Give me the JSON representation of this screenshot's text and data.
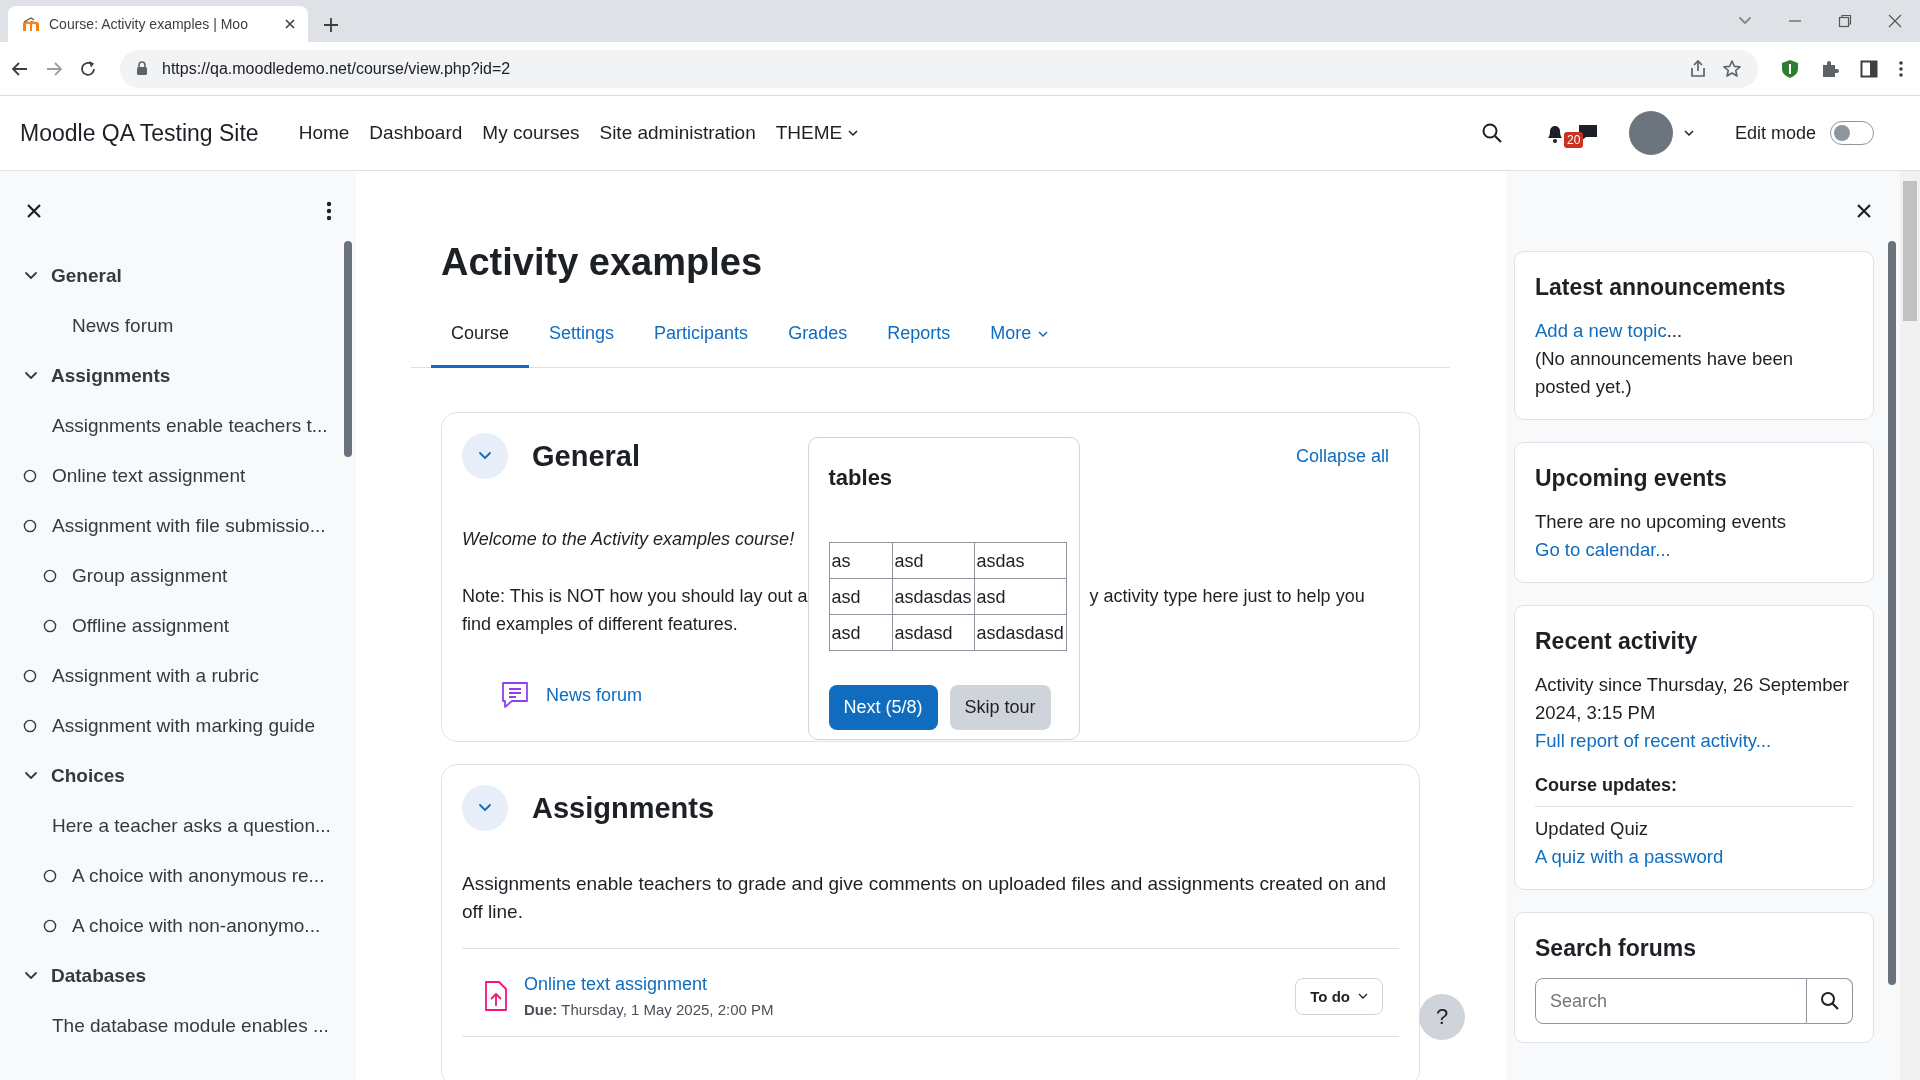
{
  "browser": {
    "tab_title": "Course: Activity examples | Moo",
    "url": "https://qa.moodledemo.net/course/view.php?id=2"
  },
  "navbar": {
    "site_name": "Moodle QA Testing Site",
    "links": [
      {
        "label": "Home",
        "dropdown": false
      },
      {
        "label": "Dashboard",
        "dropdown": false
      },
      {
        "label": "My courses",
        "dropdown": false
      },
      {
        "label": "Site administration",
        "dropdown": false
      },
      {
        "label": "THEME",
        "dropdown": true
      }
    ],
    "notification_count": "20",
    "edit_mode": {
      "label": "Edit mode",
      "on": false
    }
  },
  "course_index": {
    "sections": [
      {
        "title": "General",
        "expanded": true,
        "items": [
          {
            "label": "News forum",
            "indented": true,
            "completion": false
          }
        ]
      },
      {
        "title": "Assignments",
        "expanded": true,
        "items": [
          {
            "label": "Assignments enable teachers t...",
            "indented": false,
            "completion": false
          },
          {
            "label": "Online text assignment",
            "indented": false,
            "completion": true
          },
          {
            "label": "Assignment with file submissio...",
            "indented": false,
            "completion": true
          },
          {
            "label": "Group assignment",
            "indented": true,
            "completion": true
          },
          {
            "label": "Offline assignment",
            "indented": true,
            "completion": true
          },
          {
            "label": "Assignment with a rubric",
            "indented": false,
            "completion": true
          },
          {
            "label": "Assignment with marking guide",
            "indented": false,
            "completion": true
          }
        ]
      },
      {
        "title": "Choices",
        "expanded": true,
        "items": [
          {
            "label": "Here a teacher asks a question...",
            "indented": false,
            "completion": false
          },
          {
            "label": "A choice with anonymous re...",
            "indented": true,
            "completion": true
          },
          {
            "label": "A choice with non-anonymo...",
            "indented": true,
            "completion": true
          }
        ]
      },
      {
        "title": "Databases",
        "expanded": true,
        "items": [
          {
            "label": "The database module enables ...",
            "indented": false,
            "completion": false
          }
        ]
      }
    ]
  },
  "course": {
    "title": "Activity examples",
    "tabs": [
      {
        "label": "Course",
        "selected": true,
        "dropdown": false
      },
      {
        "label": "Settings",
        "selected": false,
        "dropdown": false
      },
      {
        "label": "Participants",
        "selected": false,
        "dropdown": false
      },
      {
        "label": "Grades",
        "selected": false,
        "dropdown": false
      },
      {
        "label": "Reports",
        "selected": false,
        "dropdown": false
      },
      {
        "label": "More",
        "selected": false,
        "dropdown": true
      }
    ],
    "sections": [
      {
        "title": "General",
        "expanded": true,
        "collapse_all": "Collapse all",
        "intro": "Welcome to the Activity examples course!",
        "note_fragments": [
          "Note: This is NOT how you should lay out a",
          "y activity type here just to help you",
          "find examples of different features."
        ],
        "activities": [
          {
            "kind": "forum",
            "name": "News forum"
          }
        ]
      },
      {
        "title": "Assignments",
        "expanded": true,
        "summary": "Assignments enable teachers to grade and give comments on uploaded files and assignments created on and off line.",
        "activities": [
          {
            "kind": "assignment",
            "name": "Online text assignment",
            "due": "**Due:** Thursday, 1 May 2025, 2:00 PM",
            "status": "To do"
          }
        ]
      }
    ]
  },
  "tour": {
    "title": "tables",
    "table": [
      [
        "as",
        "asd",
        "asdas"
      ],
      [
        "asd",
        "asdasdas",
        "asd"
      ],
      [
        "asd",
        "asdasd",
        "asdasdasd"
      ]
    ],
    "next": "Next (5/8)",
    "skip": "Skip tour"
  },
  "help_button": "?",
  "blocks": [
    {
      "title": "Latest announcements",
      "content": [
        {
          "kind": "link",
          "text": "Add a new topic",
          "suffix": "..."
        },
        {
          "kind": "text",
          "text": "(No announcements have been posted yet.)"
        }
      ]
    },
    {
      "title": "Upcoming events",
      "content": [
        {
          "kind": "text",
          "text": "There are no upcoming events"
        },
        {
          "kind": "link",
          "text": "Go to calendar..."
        }
      ]
    },
    {
      "title": "Recent activity",
      "content": [
        {
          "kind": "text",
          "text": "Activity since Thursday, 26 September 2024, 3:15 PM"
        },
        {
          "kind": "link",
          "text": "Full report of recent activity..."
        },
        {
          "kind": "subheading",
          "text": "Course updates:"
        },
        {
          "kind": "text",
          "text": "Updated Quiz"
        },
        {
          "kind": "link",
          "text": "A quiz with a password"
        }
      ]
    },
    {
      "title": "Search forums",
      "content": [
        {
          "kind": "search",
          "placeholder": "Search"
        }
      ]
    }
  ]
}
